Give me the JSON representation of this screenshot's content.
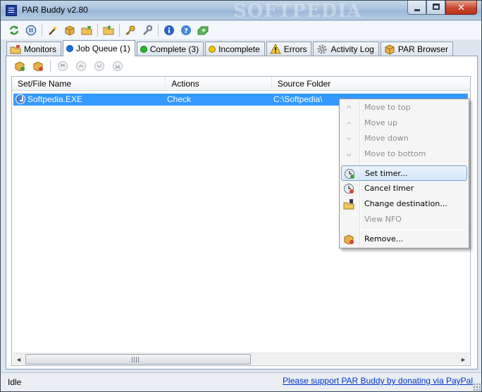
{
  "window": {
    "title": "PAR Buddy v2.80",
    "watermark": "SOFTPEDIA"
  },
  "toolbar": {
    "icons": [
      "refresh-icon",
      "pause-icon",
      "wand-icon",
      "package-icon",
      "package-open-icon",
      "folder-icon",
      "key-icon",
      "wrench-icon",
      "info-icon",
      "help-icon",
      "donate-icon"
    ]
  },
  "tabs": [
    {
      "label": "Monitors",
      "icon": "monitors-icon",
      "active": false
    },
    {
      "label": "Job Queue (1)",
      "icon": "blue-dot",
      "dot": "#1a6fe0",
      "active": true
    },
    {
      "label": "Complete (3)",
      "icon": "green-dot",
      "dot": "#23b91f",
      "active": false
    },
    {
      "label": "Incomplete",
      "icon": "yellow-dot",
      "dot": "#f2c20c",
      "active": false
    },
    {
      "label": "Errors",
      "icon": "warning-icon",
      "active": false
    },
    {
      "label": "Activity Log",
      "icon": "gear-icon",
      "active": false
    },
    {
      "label": "PAR Browser",
      "icon": "browser-icon",
      "active": false
    }
  ],
  "queue": {
    "columns": [
      "Set/File Name",
      "Actions",
      "Source Folder"
    ],
    "rows": [
      {
        "name": "Softpedia.EXE",
        "action": "Check",
        "folder": "C:\\Softpedia\\"
      }
    ],
    "scroll": {
      "left": "◄",
      "right": "►",
      "grip": "|||"
    }
  },
  "context_menu": {
    "items": [
      {
        "label": "Move to top",
        "disabled": true
      },
      {
        "label": "Move up",
        "disabled": true
      },
      {
        "label": "Move down",
        "disabled": true
      },
      {
        "label": "Move to bottom",
        "disabled": true
      },
      {
        "label": "Set timer...",
        "disabled": false,
        "hover": true
      },
      {
        "label": "Cancel timer",
        "disabled": false
      },
      {
        "label": "Change destination...",
        "disabled": false
      },
      {
        "label": "View NFO",
        "disabled": true
      },
      {
        "label": "Remove...",
        "disabled": false
      }
    ]
  },
  "status": {
    "left": "Idle",
    "link": "Please support PAR Buddy by donating via PayPal"
  },
  "colors": {
    "selection": "#3399ff",
    "link": "#0033cc",
    "close_button": "#c7472d"
  }
}
